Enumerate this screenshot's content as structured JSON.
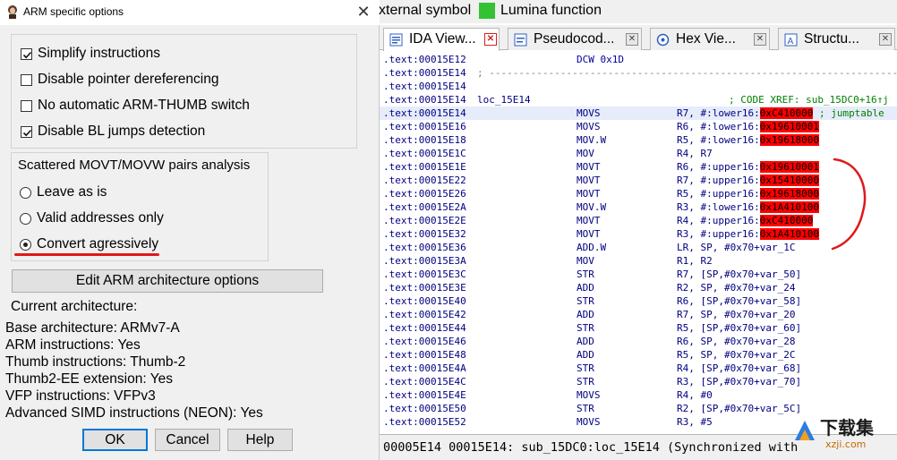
{
  "dialog": {
    "title": "ARM specific options",
    "close_glyph": "✕",
    "options": [
      {
        "label": "Simplify instructions",
        "checked": true
      },
      {
        "label": "Disable pointer dereferencing",
        "checked": false
      },
      {
        "label": "No automatic ARM-THUMB switch",
        "checked": false
      },
      {
        "label": "Disable BL jumps detection",
        "checked": true
      }
    ],
    "scattered": {
      "title": "Scattered MOVT/MOVW pairs analysis",
      "radios": [
        {
          "label": "Leave as is",
          "selected": false
        },
        {
          "label": "Valid addresses only",
          "selected": false
        },
        {
          "label": "Convert agressively",
          "selected": true
        }
      ]
    },
    "edit_button": "Edit ARM architecture options",
    "current_arch_heading": "Current architecture:",
    "arch_lines": [
      "Base architecture: ARMv7-A",
      "ARM instructions: Yes",
      "Thumb instructions: Thumb-2",
      "Thumb2-EE extension: Yes",
      "VFP instructions: VFPv3",
      "Advanced SIMD instructions (NEON): Yes"
    ],
    "buttons": {
      "ok": "OK",
      "cancel": "Cancel",
      "help": "Help"
    }
  },
  "legend": {
    "external_symbol": "xternal symbol",
    "lumina": "Lumina function",
    "lumina_color": "#34c234"
  },
  "tabs": [
    {
      "label": "IDA View...",
      "icon": "ida-view-icon",
      "active": true
    },
    {
      "label": "Pseudocod...",
      "icon": "pseudocode-icon",
      "active": false
    },
    {
      "label": "Hex Vie...",
      "icon": "hex-view-icon",
      "active": false
    },
    {
      "label": "Structu...",
      "icon": "structures-icon",
      "active": false
    }
  ],
  "listing": {
    "highlight_color": "#ff0000",
    "rows": [
      {
        "addr": ".text:00015E12",
        "kind": "dcw",
        "text": "DCW 0x1D"
      },
      {
        "addr": ".text:00015E14",
        "kind": "sep",
        "text": "; ---------------------------------------------------------------------------"
      },
      {
        "addr": ".text:00015E14",
        "kind": "blank"
      },
      {
        "addr": ".text:00015E14",
        "kind": "label",
        "label": "loc_15E14",
        "xref": "; CODE XREF: sub_15DC0+16↑j"
      },
      {
        "addr": ".text:00015E14",
        "kind": "ins",
        "selected": true,
        "mn": "MOVS",
        "pre": "R7, #:lower16:",
        "hl": "0xC410000",
        "post": "",
        "comment": " ; jumptable"
      },
      {
        "addr": ".text:00015E16",
        "kind": "ins",
        "mn": "MOVS",
        "pre": "R6, #:lower16:",
        "hl": "0x19610001",
        "post": ""
      },
      {
        "addr": ".text:00015E18",
        "kind": "ins",
        "mn": "MOV.W",
        "pre": "R5, #:lower16:",
        "hl": "0x19618000",
        "post": ""
      },
      {
        "addr": ".text:00015E1C",
        "kind": "ins",
        "mn": "MOV",
        "pre": "R4, R7",
        "hl": "",
        "post": ""
      },
      {
        "addr": ".text:00015E1E",
        "kind": "ins",
        "mn": "MOVT",
        "pre": "R6, #:upper16:",
        "hl": "0x19610001",
        "post": ""
      },
      {
        "addr": ".text:00015E22",
        "kind": "ins",
        "mn": "MOVT",
        "pre": "R7, #:upper16:",
        "hl": "0x15410000",
        "post": ""
      },
      {
        "addr": ".text:00015E26",
        "kind": "ins",
        "mn": "MOVT",
        "pre": "R5, #:upper16:",
        "hl": "0x19618000",
        "post": ""
      },
      {
        "addr": ".text:00015E2A",
        "kind": "ins",
        "mn": "MOV.W",
        "pre": "R3, #:lower16:",
        "hl": "0x1A410100",
        "post": ""
      },
      {
        "addr": ".text:00015E2E",
        "kind": "ins",
        "mn": "MOVT",
        "pre": "R4, #:upper16:",
        "hl": "0xC410000",
        "post": ""
      },
      {
        "addr": ".text:00015E32",
        "kind": "ins",
        "mn": "MOVT",
        "pre": "R3, #:upper16:",
        "hl": "0x1A410100",
        "post": ""
      },
      {
        "addr": ".text:00015E36",
        "kind": "ins",
        "mn": "ADD.W",
        "pre": "LR, SP, #0x70+var_1C",
        "hl": "",
        "post": ""
      },
      {
        "addr": ".text:00015E3A",
        "kind": "ins",
        "mn": "MOV",
        "pre": "R1, R2",
        "hl": "",
        "post": ""
      },
      {
        "addr": ".text:00015E3C",
        "kind": "ins",
        "mn": "STR",
        "pre": "R7, [SP,#0x70+var_50]",
        "hl": "",
        "post": ""
      },
      {
        "addr": ".text:00015E3E",
        "kind": "ins",
        "mn": "ADD",
        "pre": "R2, SP, #0x70+var_24",
        "hl": "",
        "post": ""
      },
      {
        "addr": ".text:00015E40",
        "kind": "ins",
        "mn": "STR",
        "pre": "R6, [SP,#0x70+var_58]",
        "hl": "",
        "post": ""
      },
      {
        "addr": ".text:00015E42",
        "kind": "ins",
        "mn": "ADD",
        "pre": "R7, SP, #0x70+var_20",
        "hl": "",
        "post": ""
      },
      {
        "addr": ".text:00015E44",
        "kind": "ins",
        "mn": "STR",
        "pre": "R5, [SP,#0x70+var_60]",
        "hl": "",
        "post": ""
      },
      {
        "addr": ".text:00015E46",
        "kind": "ins",
        "mn": "ADD",
        "pre": "R6, SP, #0x70+var_28",
        "hl": "",
        "post": ""
      },
      {
        "addr": ".text:00015E48",
        "kind": "ins",
        "mn": "ADD",
        "pre": "R5, SP, #0x70+var_2C",
        "hl": "",
        "post": ""
      },
      {
        "addr": ".text:00015E4A",
        "kind": "ins",
        "mn": "STR",
        "pre": "R4, [SP,#0x70+var_68]",
        "hl": "",
        "post": ""
      },
      {
        "addr": ".text:00015E4C",
        "kind": "ins",
        "mn": "STR",
        "pre": "R3, [SP,#0x70+var_70]",
        "hl": "",
        "post": ""
      },
      {
        "addr": ".text:00015E4E",
        "kind": "ins",
        "mn": "MOVS",
        "pre": "R4, #0",
        "hl": "",
        "post": ""
      },
      {
        "addr": ".text:00015E50",
        "kind": "ins",
        "mn": "STR",
        "pre": "R2, [SP,#0x70+var_5C]",
        "hl": "",
        "post": ""
      },
      {
        "addr": ".text:00015E52",
        "kind": "ins",
        "mn": "MOVS",
        "pre": "R3, #5",
        "hl": "",
        "post": ""
      }
    ]
  },
  "status": {
    "text": "00005E14 00015E14: sub_15DC0:loc_15E14 (Synchronized with"
  },
  "watermark": {
    "brand": "下载集",
    "site": "xzji.com"
  }
}
